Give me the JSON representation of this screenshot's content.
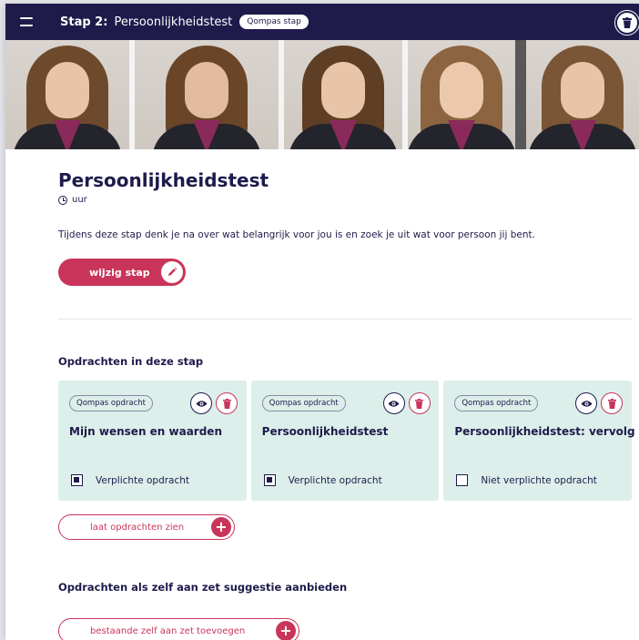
{
  "topbar": {
    "step_label": "Stap 2:",
    "step_title": "Persoonlijkheidstest",
    "badge": "Qompas stap"
  },
  "page": {
    "title": "Persoonlijkheidstest",
    "duration": "uur",
    "description": "Tijdens deze stap denk je na over wat belangrijk voor jou is en zoek je uit wat voor persoon jij bent.",
    "edit_button": "wijzig stap"
  },
  "assignments": {
    "section_title": "Opdrachten in deze stap",
    "cards": [
      {
        "badge": "Qompas opdracht",
        "title": "Mijn wensen en waarden",
        "required_label": "Verplichte opdracht",
        "required": true
      },
      {
        "badge": "Qompas opdracht",
        "title": "Persoonlijkheidstest",
        "required_label": "Verplichte opdracht",
        "required": true
      },
      {
        "badge": "Qompas opdracht",
        "title": "Persoonlijkheidstest: vervolg",
        "required_label": "Niet verplichte opdracht",
        "required": false
      }
    ],
    "show_button": "laat opdrachten zien"
  },
  "suggestions": {
    "section_title": "Opdrachten als zelf aan zet suggestie aanbieden",
    "add_button": "bestaande zelf aan zet toevoegen"
  },
  "icons": {
    "menu": "hamburger-icon",
    "delete": "trash-icon",
    "edit": "pencil-icon",
    "view": "eye-icon",
    "add": "plus-icon",
    "time": "clock-icon"
  },
  "colors": {
    "navy": "#1e1b4b",
    "accent": "#c9355a",
    "card_background": "#dcefeb"
  }
}
